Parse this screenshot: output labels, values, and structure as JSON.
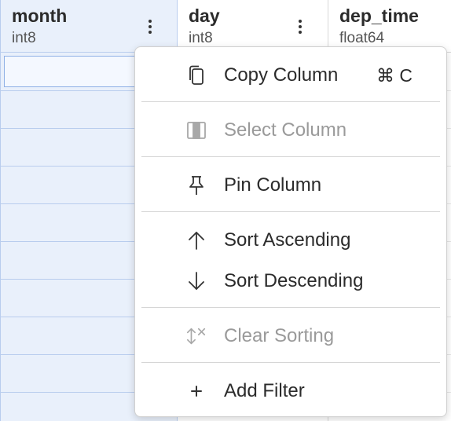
{
  "columns": [
    {
      "name": "month",
      "type": "int8"
    },
    {
      "name": "day",
      "type": "int8"
    },
    {
      "name": "dep_time",
      "type": "float64"
    }
  ],
  "context_menu": {
    "copy_column": {
      "label": "Copy Column",
      "shortcut": "⌘ C",
      "icon": "copy-icon",
      "enabled": true
    },
    "select_column": {
      "label": "Select Column",
      "icon": "select-column-icon",
      "enabled": false
    },
    "pin_column": {
      "label": "Pin Column",
      "icon": "pin-icon",
      "enabled": true
    },
    "sort_ascending": {
      "label": "Sort Ascending",
      "icon": "arrow-up-icon",
      "enabled": true
    },
    "sort_descending": {
      "label": "Sort Descending",
      "icon": "arrow-down-icon",
      "enabled": true
    },
    "clear_sorting": {
      "label": "Clear Sorting",
      "icon": "clear-sort-icon",
      "enabled": false
    },
    "add_filter": {
      "label": "Add Filter",
      "icon": "plus-icon",
      "enabled": true
    }
  },
  "colors": {
    "selected_column_bg": "#e9f0fb",
    "selected_column_border": "#b9cdee",
    "disabled_text": "#9a9a9a"
  }
}
